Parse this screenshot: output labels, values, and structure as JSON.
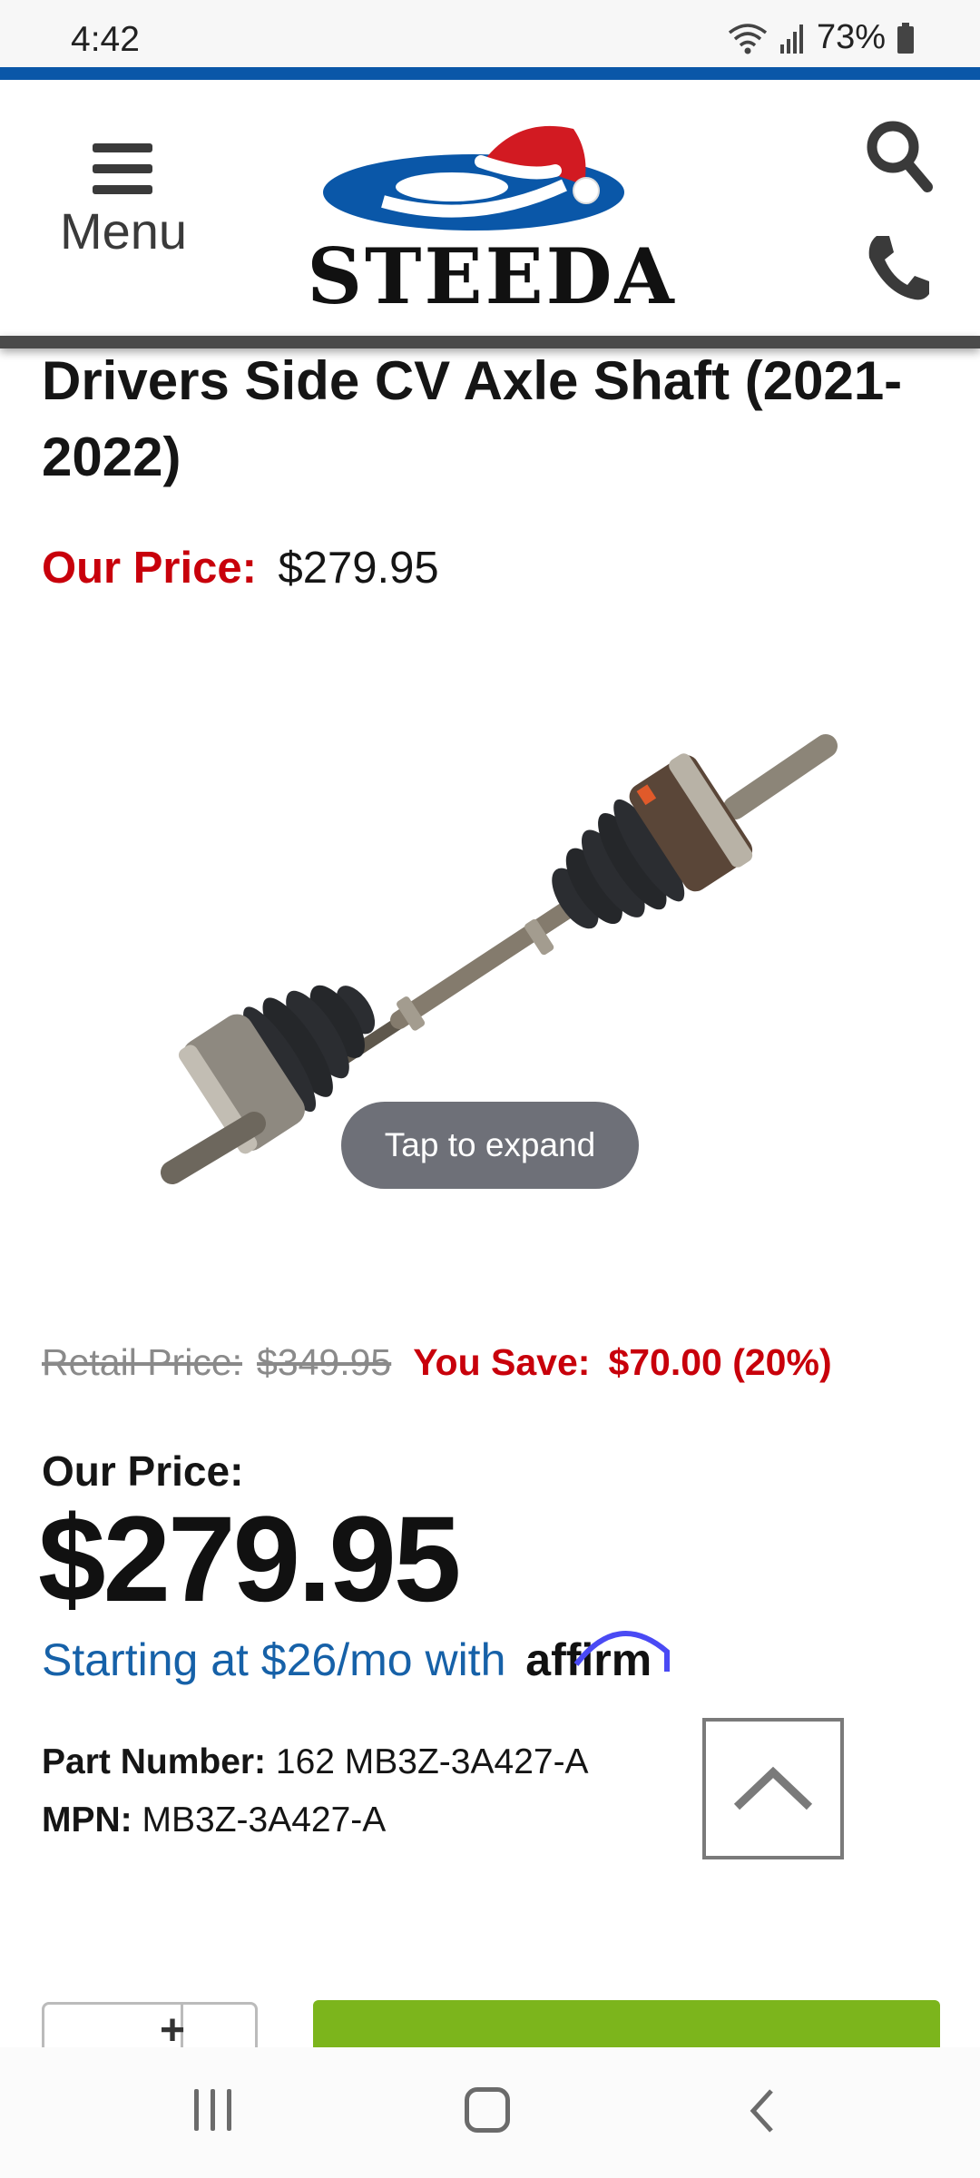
{
  "status_bar": {
    "time": "4:42",
    "battery": "73%",
    "icons": [
      "wifi-icon",
      "signal-icon",
      "battery-icon"
    ]
  },
  "header": {
    "menu_label": "Menu",
    "logo_text": "STEEDA",
    "icons": [
      "hamburger-icon",
      "search-icon",
      "phone-icon"
    ],
    "accent_color": "#0a57a8"
  },
  "product": {
    "title": "Drivers Side CV Axle Shaft (2021-2022)",
    "top_price_label": "Our Price:",
    "top_price_value": "$279.95",
    "tap_to_expand": "Tap to expand",
    "retail_label": "Retail Price:",
    "retail_value": "$349.95",
    "save_label": "You Save:",
    "save_value": "$70.00 (20%)",
    "our_price_label": "Our Price:",
    "big_price": "$279.95",
    "affirm_text": "Starting at $26/mo with",
    "affirm_brand": "affirm",
    "part_number_label": "Part Number:",
    "part_number_value": "162 MB3Z-3A427-A",
    "mpn_label": "MPN:",
    "mpn_value": "MB3Z-3A427-A",
    "qty_plus": "+"
  },
  "colors": {
    "price_red": "#c8000b",
    "affirm_blue": "#1661a8",
    "add_to_cart_green": "#7cb51c"
  },
  "nav_bar": {
    "icons": [
      "recent-apps-icon",
      "home-icon",
      "back-icon"
    ]
  }
}
